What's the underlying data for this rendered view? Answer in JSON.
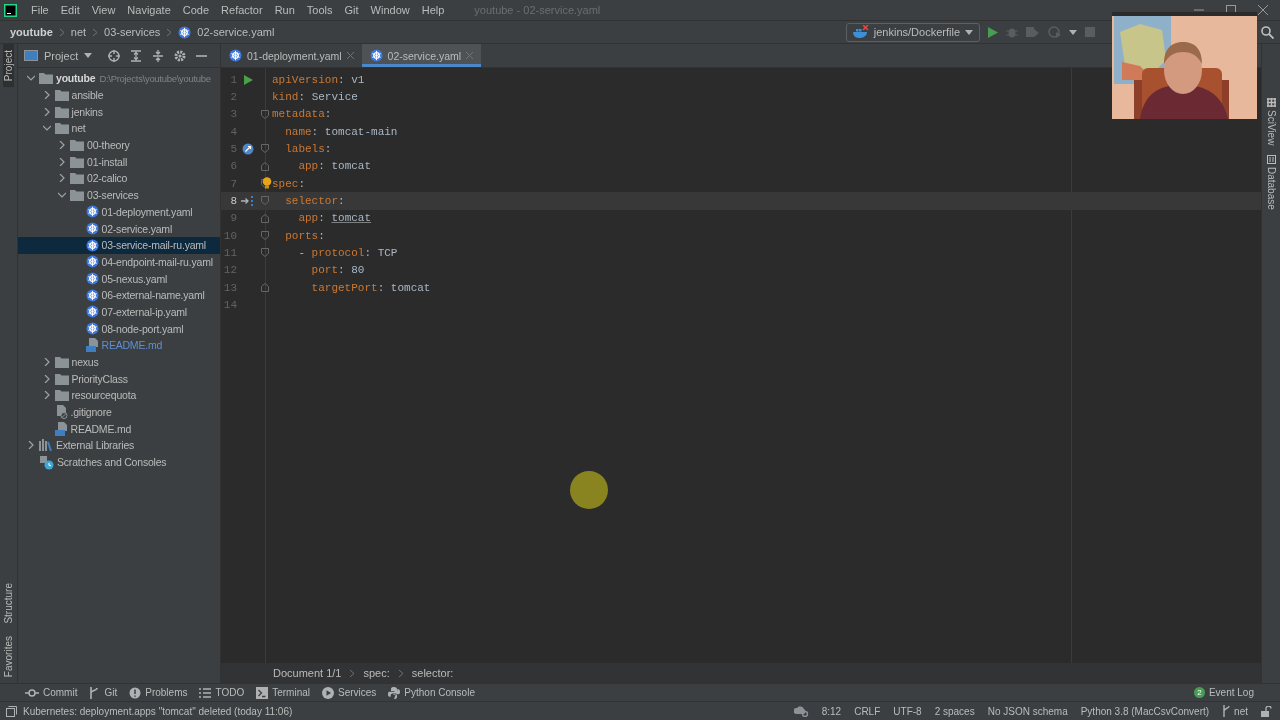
{
  "menu": {
    "items": [
      "File",
      "Edit",
      "View",
      "Navigate",
      "Code",
      "Refactor",
      "Run",
      "Tools",
      "Git",
      "Window",
      "Help"
    ],
    "window_title": "youtube - 02-service.yaml"
  },
  "breadcrumbs": [
    "youtube",
    "net",
    "03-services",
    "02-service.yaml"
  ],
  "run_config": "jenkins/Dockerfile",
  "left_strip": [
    {
      "label": "Project",
      "selected": true
    },
    {
      "label": "Structure",
      "selected": false
    },
    {
      "label": "Favorites",
      "selected": false
    }
  ],
  "right_strip": [
    {
      "label": "SciView",
      "kind": "grid"
    },
    {
      "label": "Database",
      "kind": "database"
    }
  ],
  "project": {
    "title": "Project",
    "tree": [
      {
        "label": "youtube",
        "hint": "D:\\Projects\\youtube\\youtube",
        "kind": "folder",
        "expanded": true,
        "selected": false,
        "children": [
          {
            "label": "ansible",
            "kind": "folder",
            "expanded": false,
            "selected": false
          },
          {
            "label": "jenkins",
            "kind": "folder",
            "expanded": false,
            "selected": false
          },
          {
            "label": "net",
            "kind": "folder",
            "expanded": true,
            "selected": false,
            "children": [
              {
                "label": "00-theory",
                "kind": "folder",
                "expanded": false,
                "selected": false
              },
              {
                "label": "01-install",
                "kind": "folder",
                "expanded": false,
                "selected": false
              },
              {
                "label": "02-calico",
                "kind": "folder",
                "expanded": false,
                "selected": false
              },
              {
                "label": "03-services",
                "kind": "folder",
                "expanded": true,
                "selected": false,
                "children": [
                  {
                    "label": "01-deployment.yaml",
                    "kind": "yaml",
                    "selected": false
                  },
                  {
                    "label": "02-service.yaml",
                    "kind": "yaml",
                    "selected": false
                  },
                  {
                    "label": "03-service-mail-ru.yaml",
                    "kind": "yaml",
                    "selected": true
                  },
                  {
                    "label": "04-endpoint-mail-ru.yaml",
                    "kind": "yaml",
                    "selected": false
                  },
                  {
                    "label": "05-nexus.yaml",
                    "kind": "yaml",
                    "selected": false
                  },
                  {
                    "label": "06-external-name.yaml",
                    "kind": "yaml",
                    "selected": false
                  },
                  {
                    "label": "07-external-ip.yaml",
                    "kind": "yaml",
                    "selected": false
                  },
                  {
                    "label": "08-node-port.yaml",
                    "kind": "yaml",
                    "selected": false
                  },
                  {
                    "label": "README.md",
                    "kind": "md",
                    "selected": false,
                    "color": "#5f8fd3"
                  }
                ]
              }
            ]
          },
          {
            "label": "nexus",
            "kind": "folder",
            "expanded": false,
            "selected": false
          },
          {
            "label": "PriorityClass",
            "kind": "folder",
            "expanded": false,
            "selected": false
          },
          {
            "label": "resourcequota",
            "kind": "folder",
            "expanded": false,
            "selected": false
          },
          {
            "label": ".gitignore",
            "kind": "gitignore",
            "selected": false
          },
          {
            "label": "README.md",
            "kind": "md",
            "selected": false
          }
        ]
      },
      {
        "label": "External Libraries",
        "kind": "libraries",
        "expanded": false,
        "selected": false
      },
      {
        "label": "Scratches and Consoles",
        "kind": "scratches",
        "selected": false
      }
    ]
  },
  "editor": {
    "tabs": [
      {
        "label": "01-deployment.yaml",
        "selected": false
      },
      {
        "label": "02-service.yaml",
        "selected": true
      }
    ],
    "lines": [
      {
        "number": "1",
        "code": "apiVersion: v1",
        "marker": {
          "kind": "run"
        },
        "current": false
      },
      {
        "number": "2",
        "code": "kind: Service",
        "current": false
      },
      {
        "number": "3",
        "code": "metadata:",
        "fold_start": true,
        "current": false
      },
      {
        "number": "4",
        "code": "  name: tomcat-main",
        "current": false
      },
      {
        "number": "5",
        "code": "  labels:",
        "marker": {
          "kind": "kubernetes"
        },
        "fold_start": true,
        "current": false
      },
      {
        "number": "6",
        "code": "    app: tomcat",
        "fold_end": true,
        "current": false
      },
      {
        "number": "7",
        "code": "spec:",
        "fold_start": true,
        "bulb": true,
        "current": false
      },
      {
        "number": "8",
        "code": "  selector:",
        "marker": {
          "kind": "jump"
        },
        "fold_start": true,
        "current": true
      },
      {
        "number": "9",
        "code": "    app: tomcat",
        "underlined": true,
        "fold_end": true,
        "current": false
      },
      {
        "number": "10",
        "code": "  ports:",
        "fold_start": true,
        "current": false
      },
      {
        "number": "11",
        "code": "    - protocol: TCP",
        "fold_start": true,
        "current": false
      },
      {
        "number": "12",
        "code": "      port: 80",
        "current": false
      },
      {
        "number": "13",
        "code": "      targetPort: tomcat",
        "fold_end": true,
        "current": false
      },
      {
        "number": "14",
        "current": false
      }
    ],
    "breadcrumbs": [
      "Document 1/1",
      "spec:",
      "selector:"
    ]
  },
  "tool_windows": [
    {
      "label": "Commit",
      "kind": "commit"
    },
    {
      "label": "Git",
      "kind": "git"
    },
    {
      "label": "Problems",
      "kind": "problems"
    },
    {
      "label": "TODO",
      "kind": "todo"
    },
    {
      "label": "Terminal",
      "kind": "terminal"
    },
    {
      "label": "Services",
      "kind": "services"
    },
    {
      "label": "Python Console",
      "kind": "python"
    }
  ],
  "event_log": {
    "label": "Event Log",
    "count": "2"
  },
  "status_bar": {
    "message": "Kubernetes: deployment.apps \"tomcat\" deleted (today 11:06)",
    "items": [
      "8:12",
      "CRLF",
      "UTF-8",
      "2 spaces",
      "No JSON schema",
      "Python 3.8 (MacCsvConvert)"
    ],
    "branch": "net"
  },
  "overlays": {
    "cursor_highlight": true
  }
}
